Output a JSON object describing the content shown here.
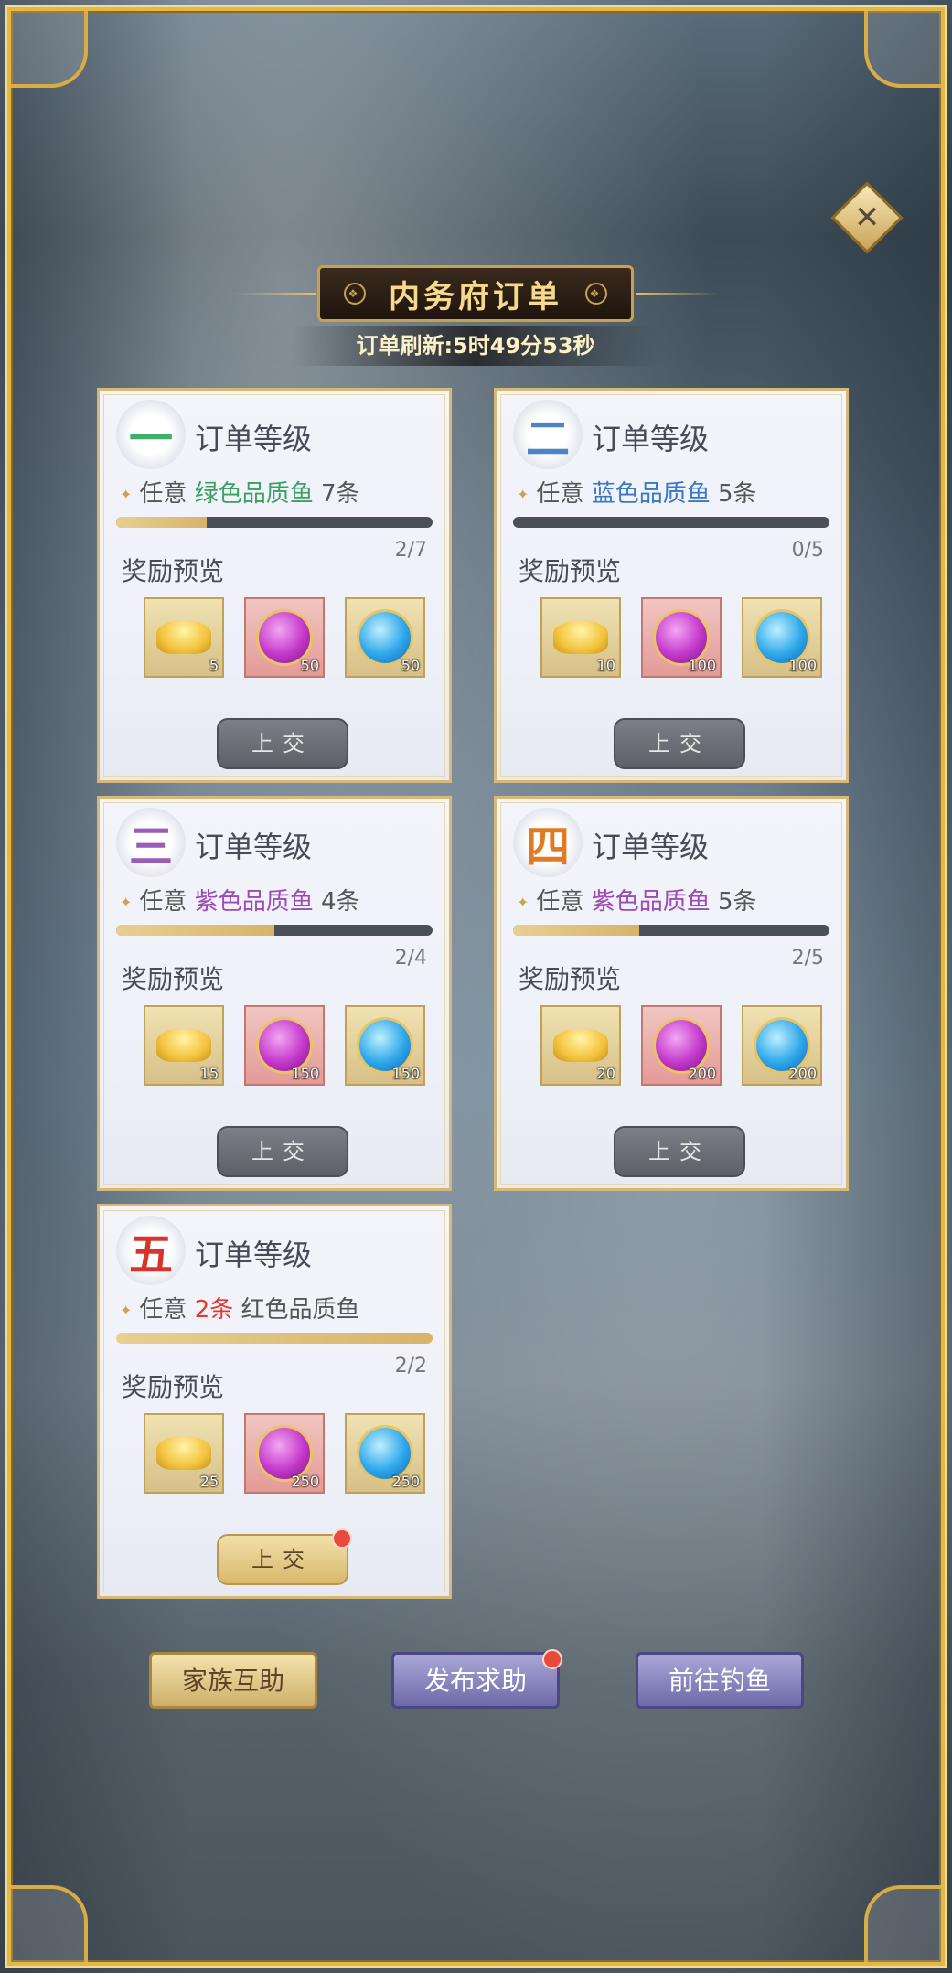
{
  "header": {
    "title": "内务府订单",
    "refresh_text": "订单刷新:5时49分53秒"
  },
  "close_icon": "close-x-icon",
  "orders": [
    {
      "seal": "一",
      "seal_color": "#3fae6a",
      "level_title": "订单等级",
      "req_prefix": "任意",
      "req_quality": "绿色品质鱼",
      "req_quality_color": "#3aa162",
      "req_count": "7条",
      "req_order": "quality-first",
      "progress_text": "2/7",
      "progress_fraction": 0.2857,
      "reward_label": "奖励预览",
      "rewards": [
        {
          "icon": "gold-ingot-icon",
          "qty": "5"
        },
        {
          "icon": "purple-orb-icon",
          "qty": "50"
        },
        {
          "icon": "blue-orb-icon",
          "qty": "50"
        }
      ],
      "submit_label": "上交",
      "submit_state": "disabled",
      "notify": false
    },
    {
      "seal": "二",
      "seal_color": "#4a86c7",
      "level_title": "订单等级",
      "req_prefix": "任意",
      "req_quality": "蓝色品质鱼",
      "req_quality_color": "#3b78c2",
      "req_count": "5条",
      "req_order": "quality-first",
      "progress_text": "0/5",
      "progress_fraction": 0,
      "reward_label": "奖励预览",
      "rewards": [
        {
          "icon": "gold-ingot-icon",
          "qty": "10"
        },
        {
          "icon": "purple-orb-icon",
          "qty": "100"
        },
        {
          "icon": "blue-orb-icon",
          "qty": "100"
        }
      ],
      "submit_label": "上交",
      "submit_state": "disabled",
      "notify": false
    },
    {
      "seal": "三",
      "seal_color": "#9b5bb8",
      "level_title": "订单等级",
      "req_prefix": "任意",
      "req_quality": "紫色品质鱼",
      "req_quality_color": "#9a4cb4",
      "req_count": "4条",
      "req_order": "quality-first",
      "progress_text": "2/4",
      "progress_fraction": 0.5,
      "reward_label": "奖励预览",
      "rewards": [
        {
          "icon": "gold-ingot-icon",
          "qty": "15"
        },
        {
          "icon": "purple-orb-icon",
          "qty": "150"
        },
        {
          "icon": "blue-orb-icon",
          "qty": "150"
        }
      ],
      "submit_label": "上交",
      "submit_state": "disabled",
      "notify": false
    },
    {
      "seal": "四",
      "seal_color": "#e27a22",
      "level_title": "订单等级",
      "req_prefix": "任意",
      "req_quality": "紫色品质鱼",
      "req_quality_color": "#9a4cb4",
      "req_count": "5条",
      "req_order": "quality-first",
      "progress_text": "2/5",
      "progress_fraction": 0.4,
      "reward_label": "奖励预览",
      "rewards": [
        {
          "icon": "gold-ingot-icon",
          "qty": "20"
        },
        {
          "icon": "purple-orb-icon",
          "qty": "200"
        },
        {
          "icon": "blue-orb-icon",
          "qty": "200"
        }
      ],
      "submit_label": "上交",
      "submit_state": "disabled",
      "notify": false
    },
    {
      "seal": "五",
      "seal_color": "#d9342b",
      "level_title": "订单等级",
      "req_prefix": "任意",
      "req_quality": "红色品质鱼",
      "req_quality_color": "#555555",
      "req_count": "2条",
      "req_count_color": "#e03a2e",
      "req_order": "count-first",
      "progress_text": "2/2",
      "progress_fraction": 1,
      "reward_label": "奖励预览",
      "rewards": [
        {
          "icon": "gold-ingot-icon",
          "qty": "25"
        },
        {
          "icon": "purple-orb-icon",
          "qty": "250"
        },
        {
          "icon": "blue-orb-icon",
          "qty": "250"
        }
      ],
      "submit_label": "上交",
      "submit_state": "active",
      "notify": true
    }
  ],
  "bottom_buttons": [
    {
      "label": "家族互助",
      "style": "gold",
      "notify": false
    },
    {
      "label": "发布求助",
      "style": "purple",
      "notify": true
    },
    {
      "label": "前往钓鱼",
      "style": "purple",
      "notify": false
    }
  ]
}
